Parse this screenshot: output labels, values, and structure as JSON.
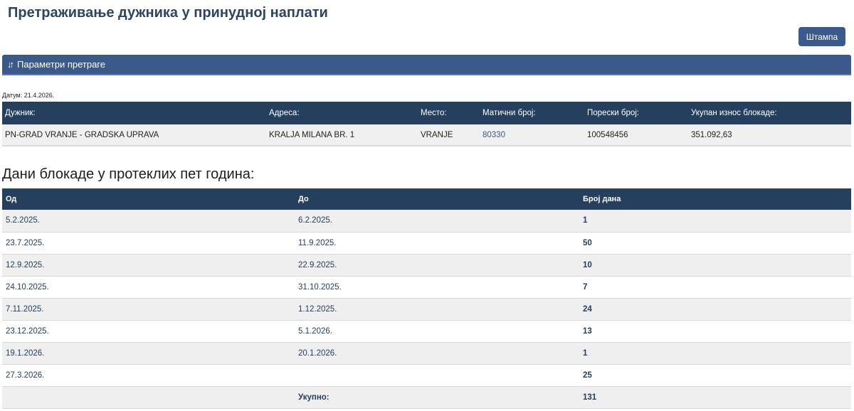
{
  "page": {
    "title": "Претраживање дужника у принудној наплати",
    "print_label": "Штампа",
    "params_label": "Параметри претраге",
    "params_icon": "sort-arrows-icon"
  },
  "date_line": "Датум: 21.4.2026.",
  "debtor": {
    "headers": {
      "debtor": "Дужник:",
      "address": "Адреса:",
      "place": "Место:",
      "reg_no": "Матични број:",
      "tax_no": "Порески број:",
      "total": "Укупан износ блокаде:"
    },
    "row": {
      "debtor": "PN-GRAD VRANJE - GRADSKA UPRAVA",
      "address": "KRALJA MILANA BR. 1",
      "place": "VRANJE",
      "reg_no": "80330",
      "tax_no": "100548456",
      "total": "351.092,63"
    }
  },
  "blockade": {
    "title": "Дани блокаде у протеклих пет година:",
    "headers": {
      "from": "Од",
      "to": "До",
      "days": "Број дана"
    },
    "rows": [
      {
        "from": "5.2.2025.",
        "to": "6.2.2025.",
        "days": "1"
      },
      {
        "from": "23.7.2025.",
        "to": "11.9.2025.",
        "days": "50"
      },
      {
        "from": "12.9.2025.",
        "to": "22.9.2025.",
        "days": "10"
      },
      {
        "from": "24.10.2025.",
        "to": "31.10.2025.",
        "days": "7"
      },
      {
        "from": "7.11.2025.",
        "to": "1.12.2025.",
        "days": "24"
      },
      {
        "from": "23.12.2025.",
        "to": "5.1.2026.",
        "days": "13"
      },
      {
        "from": "19.1.2026.",
        "to": "20.1.2026.",
        "days": "1"
      },
      {
        "from": "27.3.2026.",
        "to": "",
        "days": "25"
      }
    ],
    "total_label": "Укупно:",
    "total_days": "131"
  }
}
